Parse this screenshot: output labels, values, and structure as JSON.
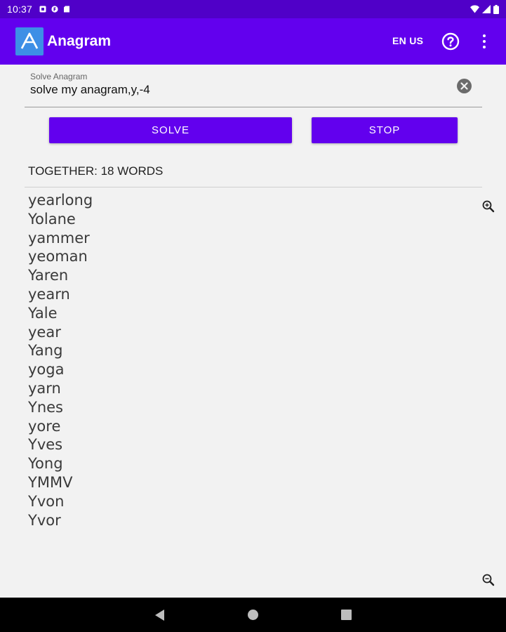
{
  "status_bar": {
    "time": "10:37",
    "icons": [
      "notification-icon",
      "notification-icon",
      "sd-card-icon",
      "wifi-icon",
      "signal-icon",
      "battery-icon"
    ]
  },
  "app_bar": {
    "title": "Anagram",
    "locale": "EN US",
    "icons": [
      "app-logo-icon",
      "help-icon",
      "more-vert-icon"
    ],
    "color": "#6200ee"
  },
  "search": {
    "label": "Solve Anagram",
    "value": "solve my anagram,y,-4"
  },
  "buttons": {
    "solve": "SOLVE",
    "stop": "STOP"
  },
  "results": {
    "header": "TOGETHER: 18 WORDS",
    "words": [
      "yearlong",
      "Yolane",
      "yammer",
      "yeoman",
      "Yaren",
      "yearn",
      "Yale",
      "year",
      "Yang",
      "yoga",
      "yarn",
      "Ynes",
      "yore",
      "Yves",
      "Yong",
      "YMMV",
      "Yvon",
      "Yvor"
    ],
    "zoom_icons": [
      "zoom-in-icon",
      "zoom-out-icon"
    ]
  },
  "nav_bar": {
    "icons": [
      "back-icon",
      "home-icon",
      "recents-icon"
    ]
  }
}
